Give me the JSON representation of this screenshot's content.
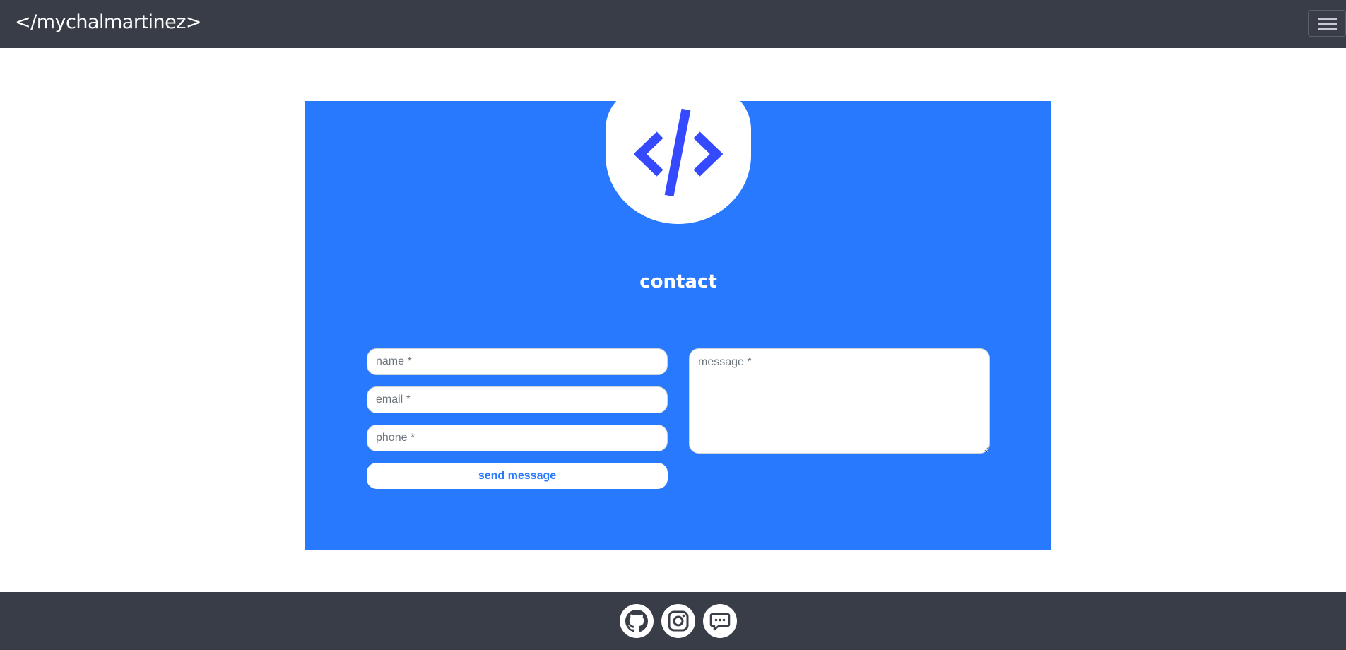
{
  "navbar": {
    "brand": "</mychalmartinez>",
    "menu_icon": "hamburger-menu-icon"
  },
  "hero": {
    "logo_icon": "code-icon",
    "title": "contact"
  },
  "form": {
    "name_placeholder": "name *",
    "email_placeholder": "email *",
    "phone_placeholder": "phone *",
    "message_placeholder": "message *",
    "send_label": "send message"
  },
  "footer": {
    "links": [
      "github-icon",
      "instagram-icon",
      "chat-icon"
    ]
  },
  "colors": {
    "nav_bg": "#393d47",
    "accent": "#2979ff",
    "logo": "#3549ff"
  }
}
